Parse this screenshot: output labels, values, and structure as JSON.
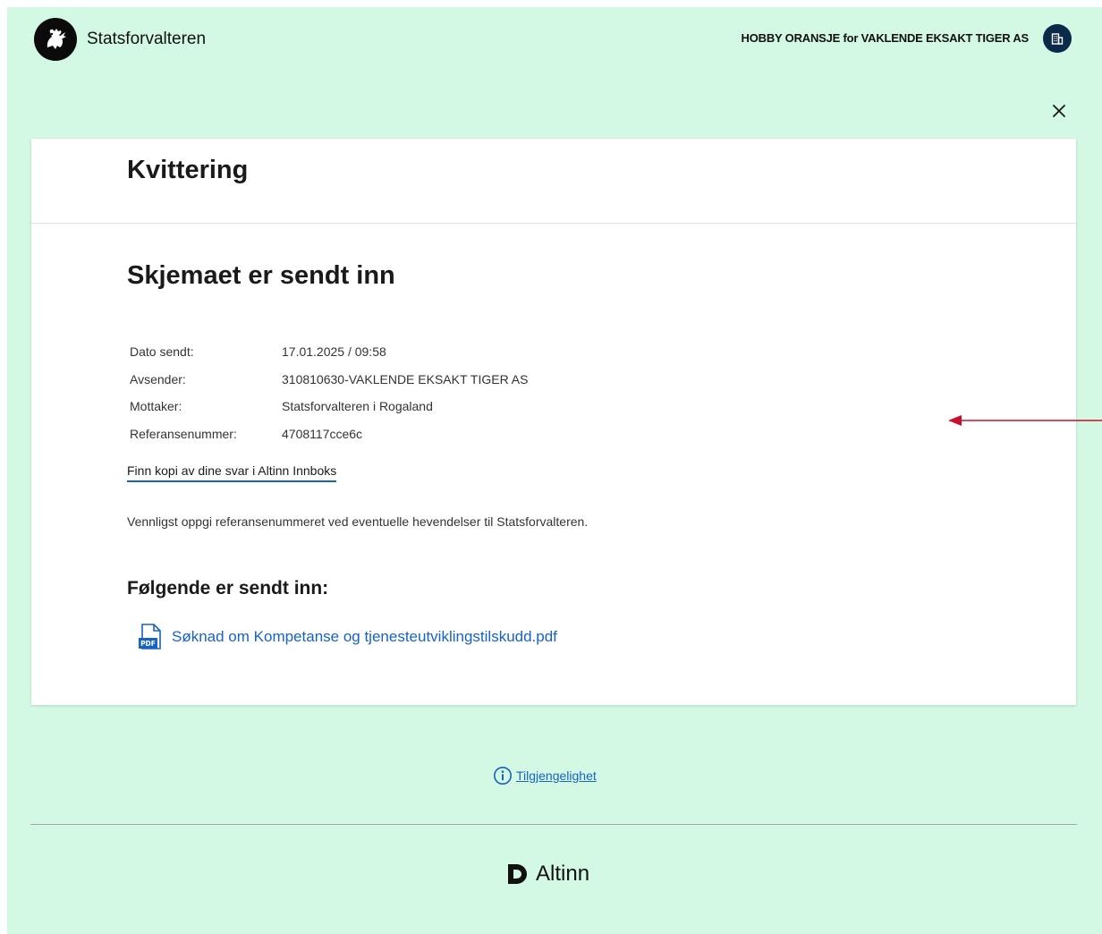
{
  "header": {
    "brand": "Statsforvalteren",
    "party": "HOBBY ORANSJE for VAKLENDE EKSAKT TIGER AS",
    "logo_icon": "coat-of-arms-icon",
    "party_icon": "building-icon",
    "close_icon": "close-icon"
  },
  "card": {
    "title": "Kvittering",
    "heading": "Skjemaet er sendt inn",
    "meta": [
      {
        "label": "Dato sendt:",
        "value": "17.01.2025 / 09:58"
      },
      {
        "label": "Avsender:",
        "value": "310810630-VAKLENDE EKSAKT TIGER AS"
      },
      {
        "label": "Mottaker:",
        "value": "Statsforvalteren i Rogaland"
      },
      {
        "label": "Referansenummer:",
        "value": "4708117cce6c"
      }
    ],
    "copy_link": "Finn kopi av dine svar i Altinn Innboks",
    "note": "Vennligst oppgi referansenummeret ved eventuelle hevendelser til Statsforvalteren.",
    "sent_heading": "Følgende er sendt inn:",
    "attachment": {
      "name": "Søknad om Kompetanse og tjenesteutviklingstilskudd.pdf",
      "icon": "pdf-file-icon",
      "icon_text": "PDF"
    }
  },
  "footer": {
    "accessibility": "Tilgjengelighet",
    "accessibility_icon": "info-icon",
    "altinn": "Altinn",
    "altinn_icon": "altinn-logo-icon"
  },
  "colors": {
    "background": "#d3f8e4",
    "link": "#1862c2",
    "annotation": "#c8102e",
    "party_badge": "#0b2a4a"
  }
}
